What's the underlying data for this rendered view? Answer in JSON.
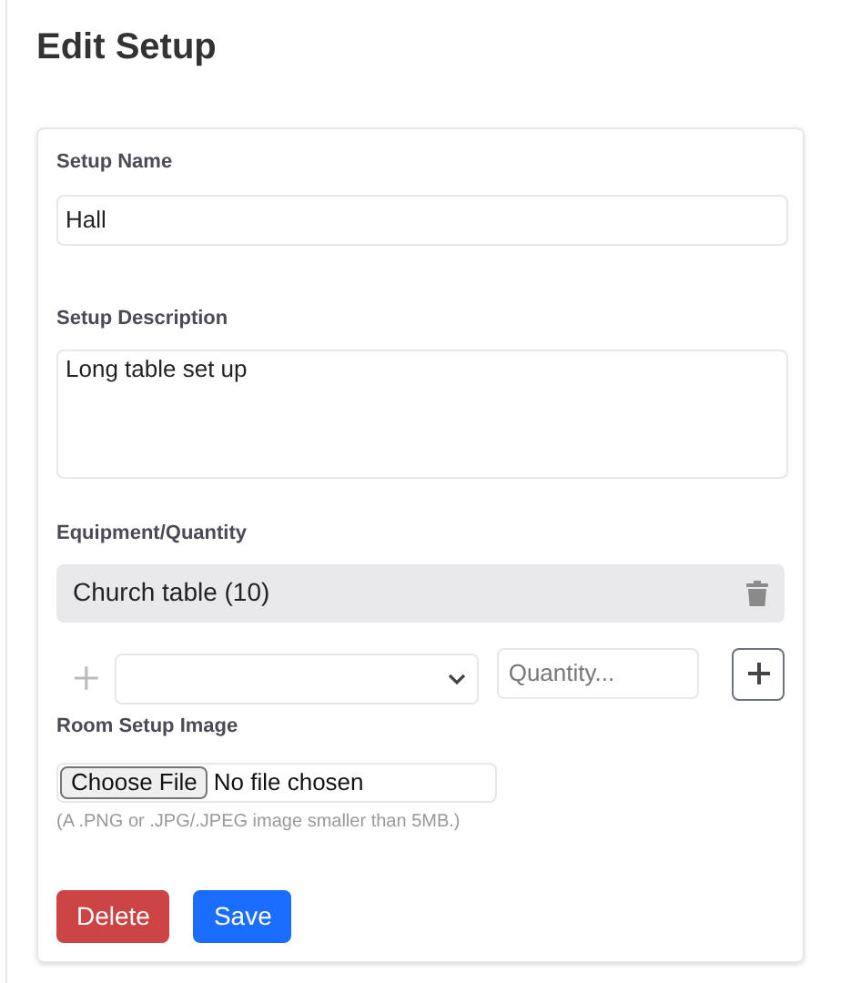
{
  "title": "Edit Setup",
  "fields": [
    {
      "kind": "text",
      "label": "Setup Name",
      "value": "Hall"
    },
    {
      "kind": "textarea",
      "label": "Setup Description",
      "value": "Long table set up"
    }
  ],
  "equipment": {
    "label": "Equipment/Quantity",
    "items": [
      "Church table (10)"
    ],
    "quantity_placeholder": "Quantity..."
  },
  "image": {
    "label": "Room Setup Image",
    "button": "Choose File",
    "status": "No file chosen",
    "hint": "(A .PNG or .JPG/.JPEG image smaller than 5MB.)"
  },
  "buttons": [
    {
      "kind": "danger",
      "label": "Delete"
    },
    {
      "kind": "primary",
      "label": "Save"
    }
  ]
}
